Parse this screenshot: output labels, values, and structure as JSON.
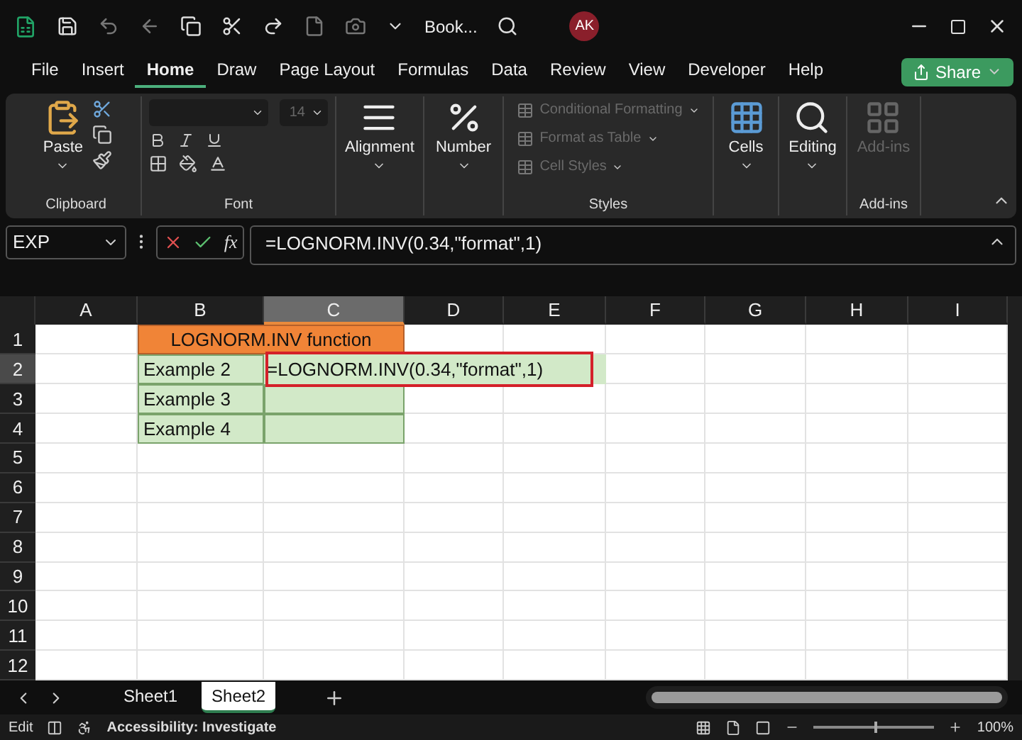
{
  "title_bar": {
    "document": "Book...",
    "avatar": "AK"
  },
  "menu": [
    {
      "label": "File",
      "selected": false
    },
    {
      "label": "Insert",
      "selected": false
    },
    {
      "label": "Home",
      "selected": true
    },
    {
      "label": "Draw",
      "selected": false
    },
    {
      "label": "Page Layout",
      "selected": false
    },
    {
      "label": "Formulas",
      "selected": false
    },
    {
      "label": "Data",
      "selected": false
    },
    {
      "label": "Review",
      "selected": false
    },
    {
      "label": "View",
      "selected": false
    },
    {
      "label": "Developer",
      "selected": false
    },
    {
      "label": "Help",
      "selected": false
    }
  ],
  "share": "Share",
  "ribbon": {
    "clipboard": {
      "paste": "Paste",
      "label": "Clipboard"
    },
    "font": {
      "size": "14",
      "label": "Font"
    },
    "alignment": "Alignment",
    "number": "Number",
    "styles": {
      "items": [
        {
          "label": "Conditional Formatting",
          "disabled": true
        },
        {
          "label": "Format as Table",
          "disabled": true
        },
        {
          "label": "Cell Styles",
          "disabled": true
        }
      ],
      "label": "Styles"
    },
    "cells": "Cells",
    "editing": "Editing",
    "addins": {
      "button": "Add-ins",
      "disabled": true,
      "label": "Add-ins"
    }
  },
  "name_box": "EXP",
  "insert_function": "fx",
  "formula": "=LOGNORM.INV(0.34,\"format\",1)",
  "columns": [
    {
      "label": "A",
      "selected": false
    },
    {
      "label": "B",
      "selected": false
    },
    {
      "label": "C",
      "selected": true
    },
    {
      "label": "D",
      "selected": false
    },
    {
      "label": "E",
      "selected": false
    },
    {
      "label": "F",
      "selected": false
    },
    {
      "label": "G",
      "selected": false
    },
    {
      "label": "H",
      "selected": false
    },
    {
      "label": "I",
      "selected": false
    }
  ],
  "rows": [
    {
      "label": "1",
      "selected": false,
      "cells": [
        {
          "kind": "blank"
        },
        {
          "kind": "title",
          "text": "LOGNORM.INV function"
        }
      ]
    },
    {
      "label": "2",
      "selected": true,
      "cells": [
        {
          "kind": "blank"
        },
        {
          "kind": "label",
          "text": "Example 2"
        },
        {
          "kind": "editing",
          "text": "=LOGNORM.INV(0.34,\"format\",1)",
          "highlighted": true
        }
      ]
    },
    {
      "label": "3",
      "selected": false,
      "cells": [
        {
          "kind": "blank"
        },
        {
          "kind": "label",
          "text": "Example 3"
        },
        {
          "kind": "fill"
        }
      ]
    },
    {
      "label": "4",
      "selected": false,
      "cells": [
        {
          "kind": "blank"
        },
        {
          "kind": "label",
          "text": "Example 4"
        },
        {
          "kind": "fill"
        }
      ]
    },
    {
      "label": "5",
      "selected": false
    },
    {
      "label": "6",
      "selected": false
    },
    {
      "label": "7",
      "selected": false
    },
    {
      "label": "8",
      "selected": false
    },
    {
      "label": "9",
      "selected": false
    },
    {
      "label": "10",
      "selected": false
    },
    {
      "label": "11",
      "selected": false
    },
    {
      "label": "12",
      "selected": false
    }
  ],
  "sheets": [
    {
      "label": "Sheet1",
      "selected": false
    },
    {
      "label": "Sheet2",
      "selected": true
    }
  ],
  "status_bar": {
    "mode": "Edit",
    "accessibility": "Accessibility: Investigate",
    "zoom": "100%",
    "zoom_slider": {
      "level": 0.5
    }
  }
}
